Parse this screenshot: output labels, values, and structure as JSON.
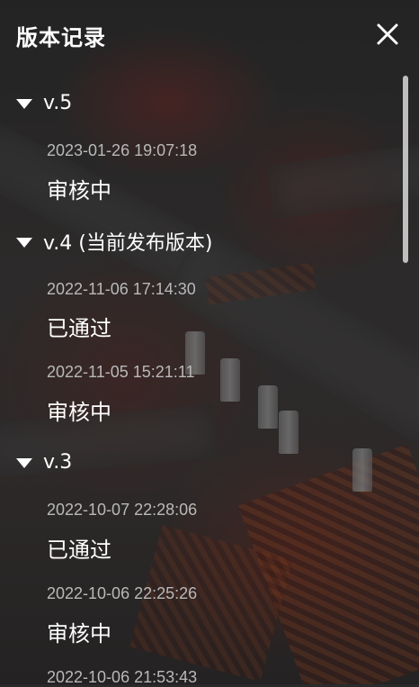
{
  "header": {
    "title": "版本记录",
    "close_icon": "close-icon"
  },
  "versions": [
    {
      "label": "v.5",
      "records": [
        {
          "time": "2023-01-26 19:07:18",
          "status": "审核中"
        }
      ]
    },
    {
      "label": "v.4 (当前发布版本)",
      "records": [
        {
          "time": "2022-11-06 17:14:30",
          "status": "已通过"
        },
        {
          "time": "2022-11-05 15:21:11",
          "status": "审核中"
        }
      ]
    },
    {
      "label": "v.3",
      "records": [
        {
          "time": "2022-10-07 22:28:06",
          "status": "已通过"
        },
        {
          "time": "2022-10-06 22:25:26",
          "status": "审核中"
        },
        {
          "time": "2022-10-06 21:53:43",
          "status": ""
        }
      ]
    }
  ],
  "colors": {
    "text": "#ffffff",
    "timestamp": "#b9b9b9",
    "overlay": "#2a2a2a"
  }
}
